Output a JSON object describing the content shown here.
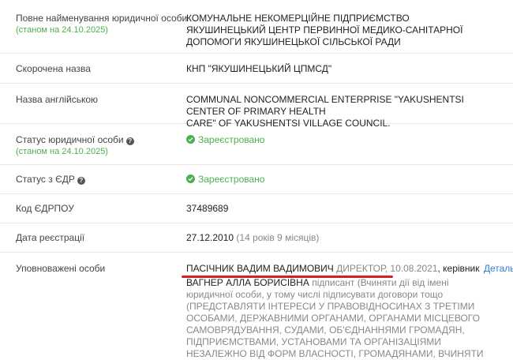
{
  "rows": {
    "full_name": {
      "label": "Повне найменування юридичної особи",
      "status_date": "(станом на 24.10.2025)",
      "value_lines": [
        "КОМУНАЛЬНЕ НЕКОМЕРЦІЙНЕ ПІДПРИЄМСТВО",
        "ЯКУШИНЕЦЬКИЙ ЦЕНТР ПЕРВИННОЇ МЕДИКО-САНІТАРНОЇ",
        "ДОПОМОГИ ЯКУШИНЕЦЬКОЇ СІЛЬСЬКОЇ РАДИ"
      ]
    },
    "short_name": {
      "label": "Скорочена назва",
      "value": "КНП \"ЯКУШИНЕЦЬКИЙ ЦПМСД\""
    },
    "english_name": {
      "label": "Назва англійською",
      "value_lines": [
        "COMMUNAL NONCOMMERCIAL ENTERPRISE \"YAKUSHENTSI CENTER OF PRIMARY HEALTH",
        "CARE\" OF YAKUSHENTSI VILLAGE COUNCIL."
      ]
    },
    "legal_status": {
      "label": "Статус юридичної особи",
      "status_date": "(станом на 24.10.2025)",
      "value": "Зареєстровано"
    },
    "edr_status": {
      "label": "Статус з ЄДР",
      "value": "Зареєстровано"
    },
    "edrpou": {
      "label": "Код ЄДРПОУ",
      "value": "37489689"
    },
    "registration_date": {
      "label": "Дата реєстрації",
      "date": "27.12.2010",
      "age": "(14 років 9 місяців)"
    },
    "authorized": {
      "label": "Уповноважені особи",
      "person1": {
        "name": "ПАСІЧНИК ВАДИМ ВАДИМОВИЧ",
        "position": "ДИРЕКТОР, 10.08.2021",
        "role": ", керівник",
        "details_link": "Детальніше"
      },
      "person2": {
        "name": "ВАГНЕР АЛЛА БОРИСІВНА",
        "role": "підписант (Вчиняти дії від імені",
        "lines": [
          "юридичної особи, у тому числі підписувати договори тощо",
          "(ПРЕДСТАВЛЯТИ ІНТЕРЕСИ У ПРАВОВІДНОСИНАХ З ТРЕТІМИ",
          "ОСОБАМИ, ДЕРЖАВНИМИ ОРГАНАМИ, ОРГАНАМИ МІСЦЕВОГО",
          "САМОВРЯДУВАННЯ, СУДАМИ, ОБ'ЄДНАННЯМИ ГРОМАДЯН,",
          "ПІДПРИЄМСТВАМИ, УСТАНОВАМИ ТА ОРГАНІЗАЦІЯМИ",
          "НЕЗАЛЕЖНО ВІД ФОРМ ВЛАСНОСТІ, ГРОМАДЯНАМИ, ВЧИНЯТИ"
        ]
      }
    }
  },
  "colors": {
    "green": "#4caf50",
    "link": "#2f80d1",
    "underline": "#d62020"
  }
}
